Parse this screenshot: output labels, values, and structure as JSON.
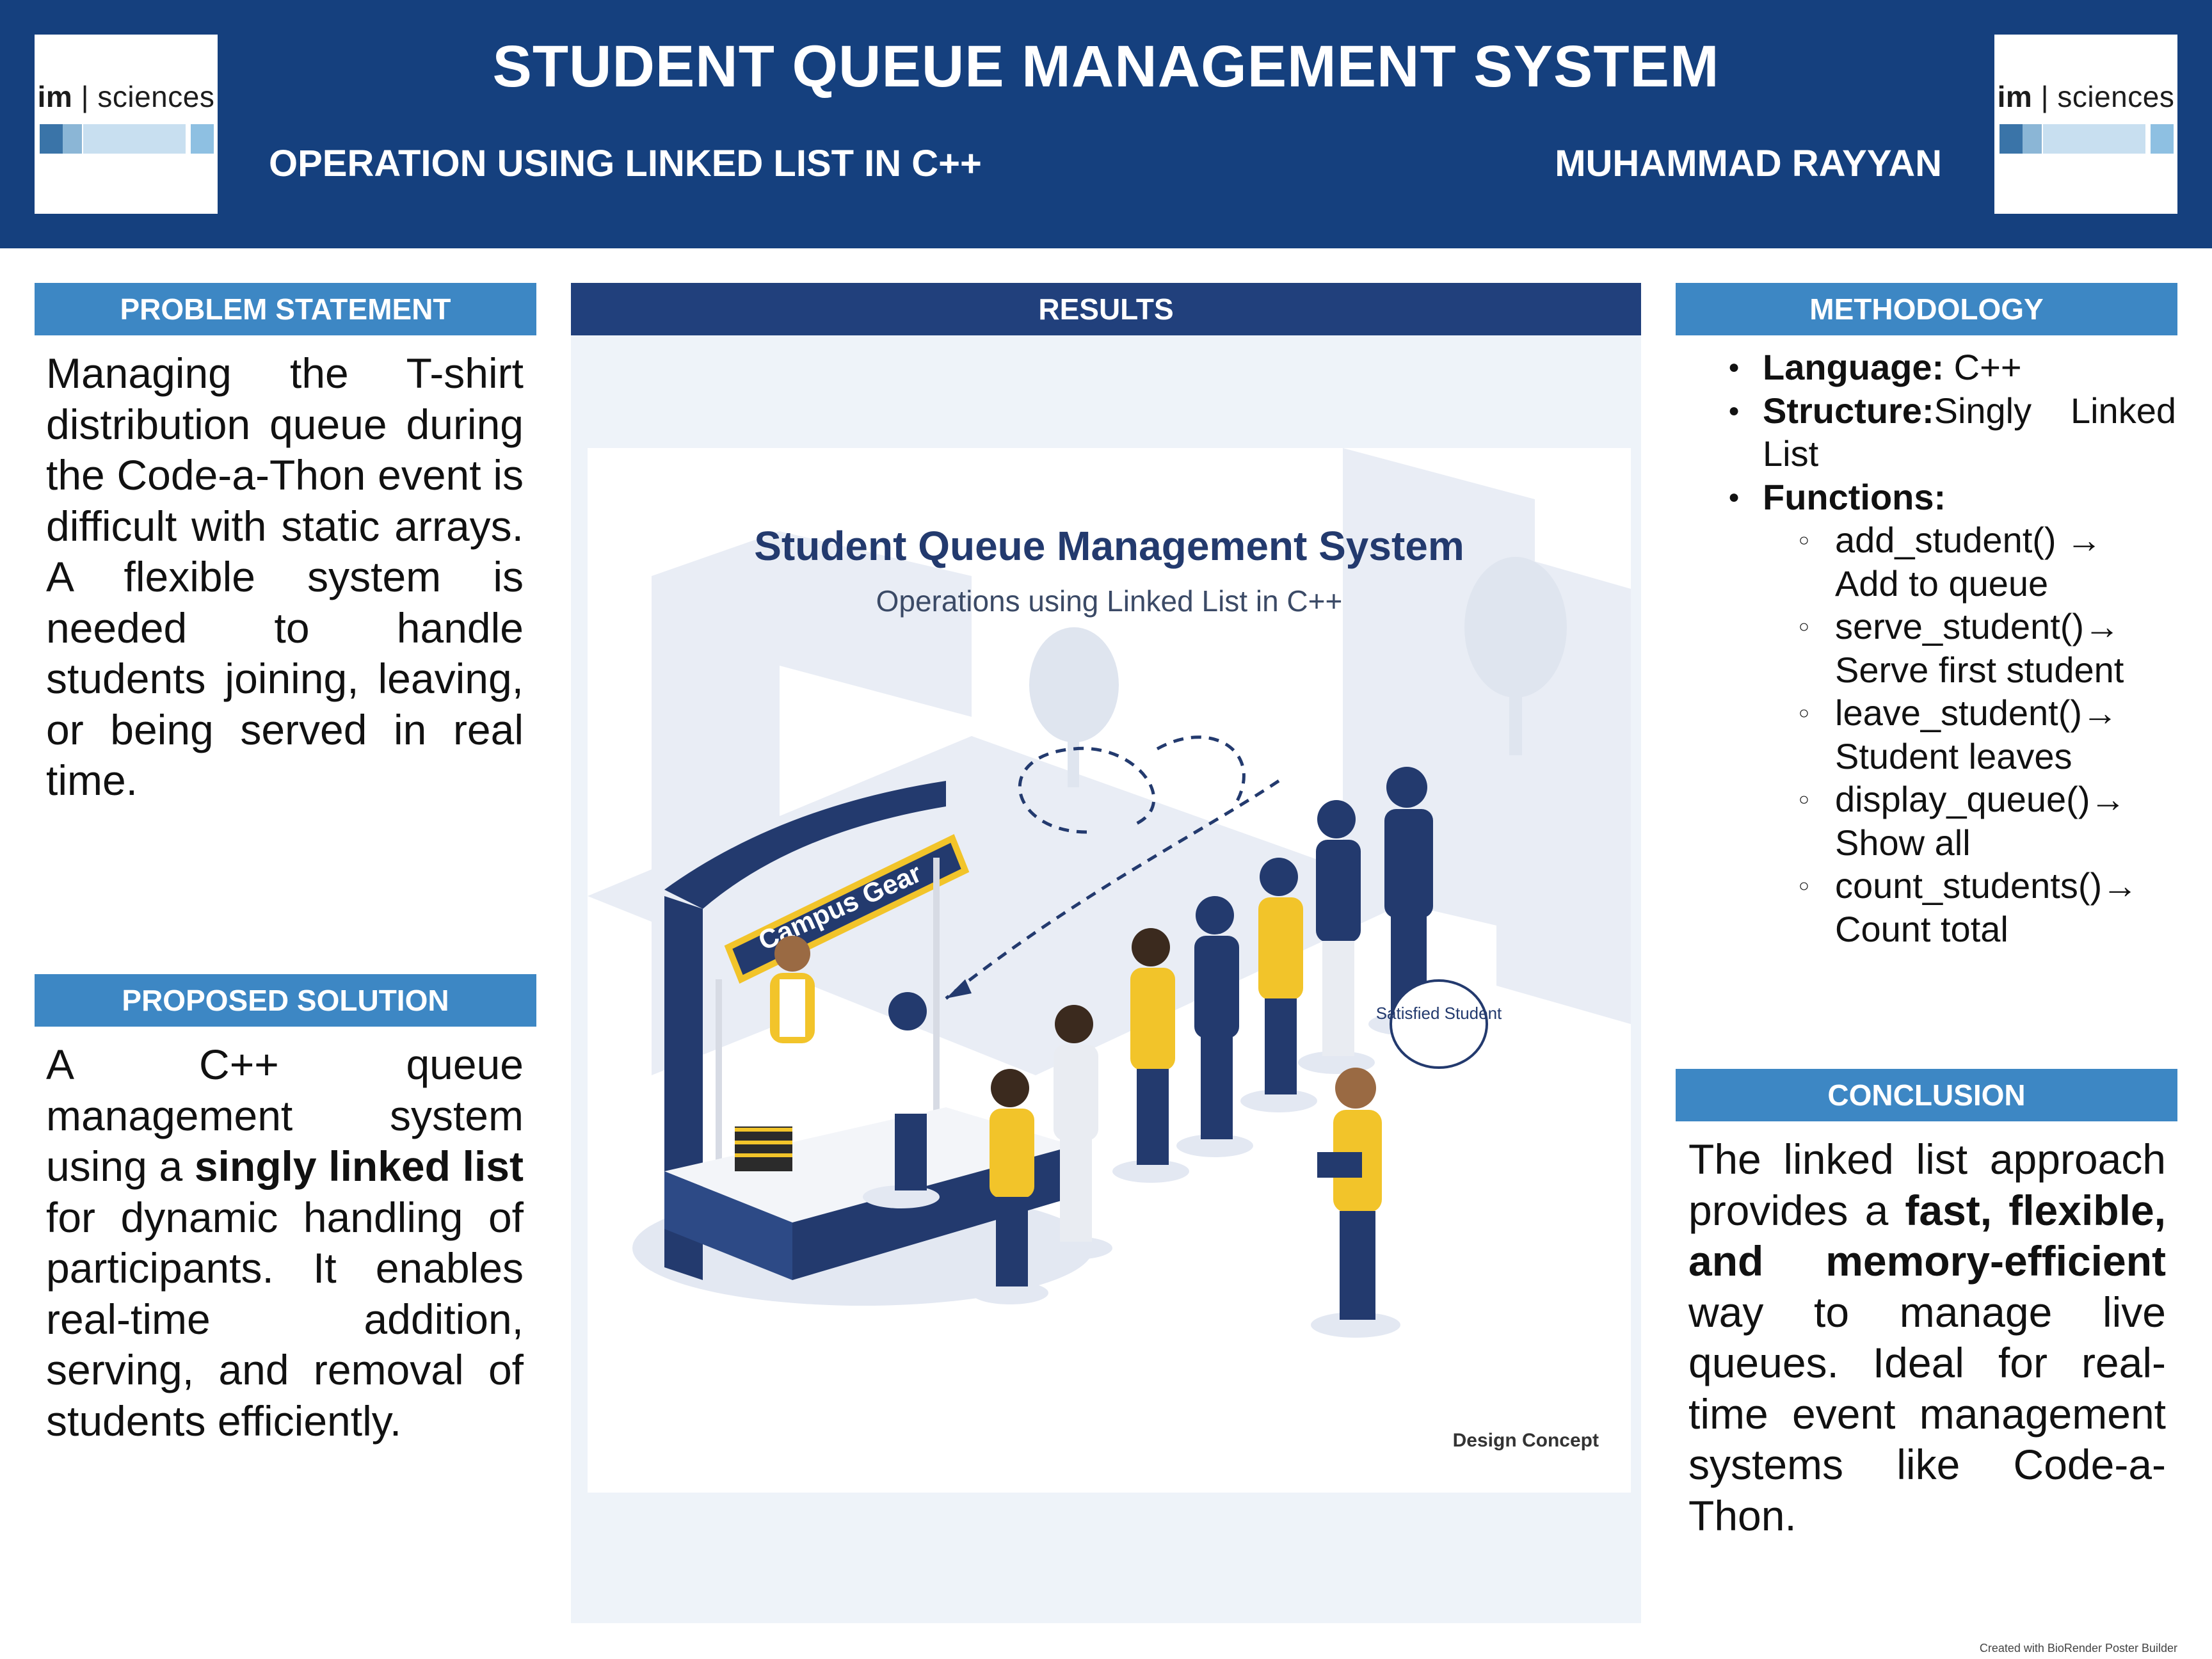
{
  "header": {
    "title": "STUDENT QUEUE MANAGEMENT SYSTEM",
    "subtitle": "OPERATION USING LINKED LIST IN C++",
    "author": "MUHAMMAD RAYYAN",
    "logo": {
      "brand_bold": "im",
      "separator": "|",
      "brand": "sciences"
    },
    "background_color": "#15407e"
  },
  "problem": {
    "heading": "PROBLEM STATEMENT",
    "text": "Managing the T-shirt distribution queue during the Code-a-Thon event is difficult with static arrays. A flexible system is needed to handle students joining, leaving, or being served in real time."
  },
  "solution": {
    "heading": "PROPOSED SOLUTION",
    "text_before": "A C++ queue management system using a ",
    "text_bold": "singly linked list",
    "text_after": " for dynamic handling of participants. It enables real-time addition, serving, and removal of students efficiently."
  },
  "results": {
    "heading": "RESULTS",
    "figure": {
      "title": "Student Queue Management System",
      "subtitle": "Operations using Linked List in C++",
      "booth_sign": "Campus Gear",
      "shirt_label": "Campus Gear",
      "speech_bubble": "Satisfied Student",
      "caption": "Design Concept"
    }
  },
  "methodology": {
    "heading": "METHODOLOGY",
    "language_label": "Language:",
    "language_value": " C++",
    "structure_label": "Structure:",
    "structure_value": "Singly Linked List",
    "functions_label": "Functions:",
    "functions": [
      {
        "name": "add_student() →",
        "desc": "Add to queue"
      },
      {
        "name": "serve_student()→",
        "desc": "Serve first student"
      },
      {
        "name": "leave_student()→",
        "desc": "Student leaves"
      },
      {
        "name": "display_queue()→",
        "desc": "Show all"
      },
      {
        "name": "count_students()→",
        "desc": "Count total"
      }
    ]
  },
  "conclusion": {
    "heading": "CONCLUSION",
    "text_before": "The linked list approach provides a ",
    "text_bold": "fast, flexible, and memory-efficient",
    "text_after": " way to manage live queues. Ideal for real-time event management systems like Code-a-Thon."
  },
  "footer": {
    "credit": "Created with BioRender Poster Builder"
  },
  "colors": {
    "section_heading": "#3d87c4",
    "results_heading": "#21407c",
    "results_panel": "#eef3f9",
    "figure_navy": "#233a6e",
    "figure_yellow": "#f2c42a"
  }
}
